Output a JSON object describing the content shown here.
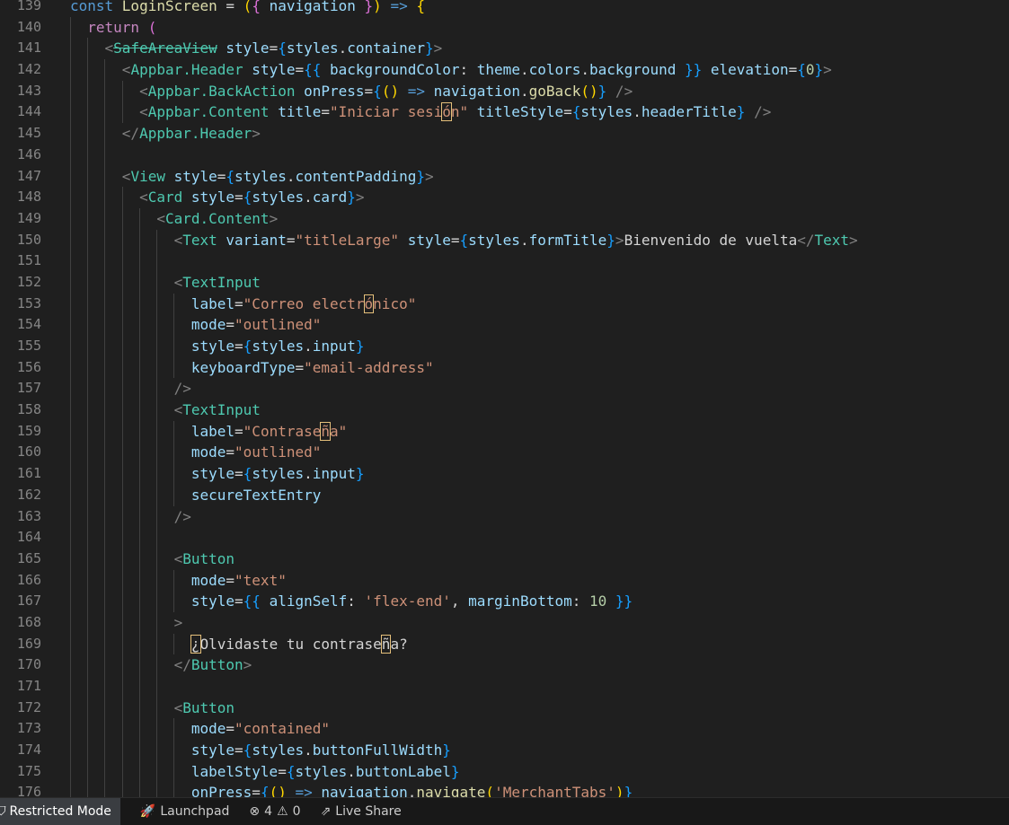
{
  "editor": {
    "lines": [
      {
        "n": "139",
        "indent": 0,
        "toks": [
          [
            "const ",
            "kw"
          ],
          [
            "LoginScreen",
            "fn"
          ],
          [
            " = ",
            "op"
          ],
          [
            "(",
            "b1"
          ],
          [
            "{ ",
            "b2"
          ],
          [
            "navigation",
            "var"
          ],
          [
            " }",
            "b2"
          ],
          [
            ")",
            "b1"
          ],
          [
            " => ",
            "kw"
          ],
          [
            "{",
            "b1"
          ]
        ]
      },
      {
        "n": "140",
        "indent": 1,
        "toks": [
          [
            "  return ",
            "ctl"
          ],
          [
            "(",
            "b2"
          ]
        ]
      },
      {
        "n": "141",
        "indent": 2,
        "toks": [
          [
            "    ",
            ""
          ],
          [
            "<",
            "brk"
          ],
          [
            "SafeAreaView",
            "tag strike"
          ],
          [
            " style",
            "attr"
          ],
          [
            "=",
            "op"
          ],
          [
            "{",
            "b3"
          ],
          [
            "styles",
            "var"
          ],
          [
            ".",
            "op"
          ],
          [
            "container",
            "var"
          ],
          [
            "}",
            "b3"
          ],
          [
            ">",
            "brk"
          ]
        ]
      },
      {
        "n": "142",
        "indent": 3,
        "toks": [
          [
            "      ",
            ""
          ],
          [
            "<",
            "brk"
          ],
          [
            "Appbar.Header",
            "tag"
          ],
          [
            " style",
            "attr"
          ],
          [
            "=",
            "op"
          ],
          [
            "{{ ",
            "b3"
          ],
          [
            "backgroundColor",
            "var"
          ],
          [
            ": ",
            "op"
          ],
          [
            "theme",
            "var"
          ],
          [
            ".",
            "op"
          ],
          [
            "colors",
            "var"
          ],
          [
            ".",
            "op"
          ],
          [
            "background",
            "var"
          ],
          [
            " }}",
            "b3"
          ],
          [
            " elevation",
            "attr"
          ],
          [
            "=",
            "op"
          ],
          [
            "{",
            "b3"
          ],
          [
            "0",
            "num"
          ],
          [
            "}",
            "b3"
          ],
          [
            ">",
            "brk"
          ]
        ]
      },
      {
        "n": "143",
        "indent": 4,
        "toks": [
          [
            "        ",
            ""
          ],
          [
            "<",
            "brk"
          ],
          [
            "Appbar.BackAction",
            "tag"
          ],
          [
            " onPress",
            "attr"
          ],
          [
            "=",
            "op"
          ],
          [
            "{",
            "b3"
          ],
          [
            "() ",
            "b1"
          ],
          [
            "=> ",
            "kw"
          ],
          [
            "navigation",
            "var"
          ],
          [
            ".",
            "op"
          ],
          [
            "goBack",
            "fn"
          ],
          [
            "()",
            "b1"
          ],
          [
            "}",
            "b3"
          ],
          [
            " />",
            "brk"
          ]
        ]
      },
      {
        "n": "144",
        "indent": 4,
        "toks": [
          [
            "        ",
            ""
          ],
          [
            "<",
            "brk"
          ],
          [
            "Appbar.Content",
            "tag"
          ],
          [
            " title",
            "attr"
          ],
          [
            "=",
            "op"
          ],
          [
            "\"Iniciar sesi",
            "str"
          ],
          [
            "ó",
            "str hl"
          ],
          [
            "n\"",
            "str"
          ],
          [
            " titleStyle",
            "attr"
          ],
          [
            "=",
            "op"
          ],
          [
            "{",
            "b3"
          ],
          [
            "styles",
            "var"
          ],
          [
            ".",
            "op"
          ],
          [
            "headerTitle",
            "var"
          ],
          [
            "}",
            "b3"
          ],
          [
            " />",
            "brk"
          ]
        ]
      },
      {
        "n": "145",
        "indent": 3,
        "toks": [
          [
            "      ",
            ""
          ],
          [
            "</",
            "brk"
          ],
          [
            "Appbar.Header",
            "tag"
          ],
          [
            ">",
            "brk"
          ]
        ]
      },
      {
        "n": "146",
        "indent": 3,
        "toks": []
      },
      {
        "n": "147",
        "indent": 3,
        "toks": [
          [
            "      ",
            ""
          ],
          [
            "<",
            "brk"
          ],
          [
            "View",
            "tag"
          ],
          [
            " style",
            "attr"
          ],
          [
            "=",
            "op"
          ],
          [
            "{",
            "b3"
          ],
          [
            "styles",
            "var"
          ],
          [
            ".",
            "op"
          ],
          [
            "contentPadding",
            "var"
          ],
          [
            "}",
            "b3"
          ],
          [
            ">",
            "brk"
          ]
        ]
      },
      {
        "n": "148",
        "indent": 4,
        "toks": [
          [
            "        ",
            ""
          ],
          [
            "<",
            "brk"
          ],
          [
            "Card",
            "tag"
          ],
          [
            " style",
            "attr"
          ],
          [
            "=",
            "op"
          ],
          [
            "{",
            "b3"
          ],
          [
            "styles",
            "var"
          ],
          [
            ".",
            "op"
          ],
          [
            "card",
            "var"
          ],
          [
            "}",
            "b3"
          ],
          [
            ">",
            "brk"
          ]
        ]
      },
      {
        "n": "149",
        "indent": 5,
        "toks": [
          [
            "          ",
            ""
          ],
          [
            "<",
            "brk"
          ],
          [
            "Card.Content",
            "tag"
          ],
          [
            ">",
            "brk"
          ]
        ]
      },
      {
        "n": "150",
        "indent": 6,
        "toks": [
          [
            "            ",
            ""
          ],
          [
            "<",
            "brk"
          ],
          [
            "Text",
            "tag"
          ],
          [
            " variant",
            "attr"
          ],
          [
            "=",
            "op"
          ],
          [
            "\"titleLarge\"",
            "str"
          ],
          [
            " style",
            "attr"
          ],
          [
            "=",
            "op"
          ],
          [
            "{",
            "b3"
          ],
          [
            "styles",
            "var"
          ],
          [
            ".",
            "op"
          ],
          [
            "formTitle",
            "var"
          ],
          [
            "}",
            "b3"
          ],
          [
            ">",
            "brk"
          ],
          [
            "Bienvenido de vuelta",
            "op"
          ],
          [
            "</",
            "brk"
          ],
          [
            "Text",
            "tag"
          ],
          [
            ">",
            "brk"
          ]
        ]
      },
      {
        "n": "151",
        "indent": 6,
        "toks": []
      },
      {
        "n": "152",
        "indent": 6,
        "toks": [
          [
            "            ",
            ""
          ],
          [
            "<",
            "brk"
          ],
          [
            "TextInput",
            "tag"
          ]
        ]
      },
      {
        "n": "153",
        "indent": 7,
        "toks": [
          [
            "              label",
            "attr"
          ],
          [
            "=",
            "op"
          ],
          [
            "\"Correo electr",
            "str"
          ],
          [
            "ó",
            "str hl"
          ],
          [
            "nico\"",
            "str"
          ]
        ]
      },
      {
        "n": "154",
        "indent": 7,
        "toks": [
          [
            "              mode",
            "attr"
          ],
          [
            "=",
            "op"
          ],
          [
            "\"outlined\"",
            "str"
          ]
        ]
      },
      {
        "n": "155",
        "indent": 7,
        "toks": [
          [
            "              style",
            "attr"
          ],
          [
            "=",
            "op"
          ],
          [
            "{",
            "b3"
          ],
          [
            "styles",
            "var"
          ],
          [
            ".",
            "op"
          ],
          [
            "input",
            "var"
          ],
          [
            "}",
            "b3"
          ]
        ]
      },
      {
        "n": "156",
        "indent": 7,
        "toks": [
          [
            "              keyboardType",
            "attr"
          ],
          [
            "=",
            "op"
          ],
          [
            "\"email-address\"",
            "str"
          ]
        ]
      },
      {
        "n": "157",
        "indent": 6,
        "toks": [
          [
            "            ",
            ""
          ],
          [
            "/>",
            "brk"
          ]
        ]
      },
      {
        "n": "158",
        "indent": 6,
        "toks": [
          [
            "            ",
            ""
          ],
          [
            "<",
            "brk"
          ],
          [
            "TextInput",
            "tag"
          ]
        ]
      },
      {
        "n": "159",
        "indent": 7,
        "toks": [
          [
            "              label",
            "attr"
          ],
          [
            "=",
            "op"
          ],
          [
            "\"Contrase",
            "str"
          ],
          [
            "ñ",
            "str hl"
          ],
          [
            "a\"",
            "str"
          ]
        ]
      },
      {
        "n": "160",
        "indent": 7,
        "toks": [
          [
            "              mode",
            "attr"
          ],
          [
            "=",
            "op"
          ],
          [
            "\"outlined\"",
            "str"
          ]
        ]
      },
      {
        "n": "161",
        "indent": 7,
        "toks": [
          [
            "              style",
            "attr"
          ],
          [
            "=",
            "op"
          ],
          [
            "{",
            "b3"
          ],
          [
            "styles",
            "var"
          ],
          [
            ".",
            "op"
          ],
          [
            "input",
            "var"
          ],
          [
            "}",
            "b3"
          ]
        ]
      },
      {
        "n": "162",
        "indent": 7,
        "toks": [
          [
            "              secureTextEntry",
            "attr"
          ]
        ]
      },
      {
        "n": "163",
        "indent": 6,
        "toks": [
          [
            "            ",
            ""
          ],
          [
            "/>",
            "brk"
          ]
        ]
      },
      {
        "n": "164",
        "indent": 6,
        "toks": []
      },
      {
        "n": "165",
        "indent": 6,
        "toks": [
          [
            "            ",
            ""
          ],
          [
            "<",
            "brk"
          ],
          [
            "Button",
            "tag"
          ]
        ]
      },
      {
        "n": "166",
        "indent": 7,
        "toks": [
          [
            "              mode",
            "attr"
          ],
          [
            "=",
            "op"
          ],
          [
            "\"text\"",
            "str"
          ]
        ]
      },
      {
        "n": "167",
        "indent": 7,
        "toks": [
          [
            "              style",
            "attr"
          ],
          [
            "=",
            "op"
          ],
          [
            "{{ ",
            "b3"
          ],
          [
            "alignSelf",
            "var"
          ],
          [
            ": ",
            "op"
          ],
          [
            "'flex-end'",
            "str"
          ],
          [
            ", ",
            "op"
          ],
          [
            "marginBottom",
            "var"
          ],
          [
            ": ",
            "op"
          ],
          [
            "10",
            "num"
          ],
          [
            " }}",
            "b3"
          ]
        ]
      },
      {
        "n": "168",
        "indent": 6,
        "toks": [
          [
            "            ",
            ""
          ],
          [
            ">",
            "brk"
          ]
        ]
      },
      {
        "n": "169",
        "indent": 7,
        "toks": [
          [
            "              ",
            ""
          ],
          [
            "¿",
            "op hl"
          ],
          [
            "Olvidaste tu contrase",
            "op"
          ],
          [
            "ñ",
            "op hl"
          ],
          [
            "a?",
            "op"
          ]
        ]
      },
      {
        "n": "170",
        "indent": 6,
        "toks": [
          [
            "            ",
            ""
          ],
          [
            "</",
            "brk"
          ],
          [
            "Button",
            "tag"
          ],
          [
            ">",
            "brk"
          ]
        ]
      },
      {
        "n": "171",
        "indent": 6,
        "toks": []
      },
      {
        "n": "172",
        "indent": 6,
        "toks": [
          [
            "            ",
            ""
          ],
          [
            "<",
            "brk"
          ],
          [
            "Button",
            "tag"
          ]
        ]
      },
      {
        "n": "173",
        "indent": 7,
        "toks": [
          [
            "              mode",
            "attr"
          ],
          [
            "=",
            "op"
          ],
          [
            "\"contained\"",
            "str"
          ]
        ]
      },
      {
        "n": "174",
        "indent": 7,
        "toks": [
          [
            "              style",
            "attr"
          ],
          [
            "=",
            "op"
          ],
          [
            "{",
            "b3"
          ],
          [
            "styles",
            "var"
          ],
          [
            ".",
            "op"
          ],
          [
            "buttonFullWidth",
            "var"
          ],
          [
            "}",
            "b3"
          ]
        ]
      },
      {
        "n": "175",
        "indent": 7,
        "toks": [
          [
            "              labelStyle",
            "attr"
          ],
          [
            "=",
            "op"
          ],
          [
            "{",
            "b3"
          ],
          [
            "styles",
            "var"
          ],
          [
            ".",
            "op"
          ],
          [
            "buttonLabel",
            "var"
          ],
          [
            "}",
            "b3"
          ]
        ]
      },
      {
        "n": "176",
        "indent": 7,
        "toks": [
          [
            "              onPress",
            "attr"
          ],
          [
            "=",
            "op"
          ],
          [
            "{",
            "b3"
          ],
          [
            "() ",
            "b1"
          ],
          [
            "=> ",
            "kw"
          ],
          [
            "navigation",
            "var"
          ],
          [
            ".",
            "op"
          ],
          [
            "navigate",
            "fn"
          ],
          [
            "(",
            "b1"
          ],
          [
            "'MerchantTabs'",
            "str"
          ],
          [
            ")",
            "b1"
          ],
          [
            "}",
            "b3"
          ]
        ]
      }
    ]
  },
  "statusbar": {
    "restricted_label": "Restricted Mode",
    "launchpad_label": "Launchpad",
    "errors_count": "4",
    "warnings_count": "0",
    "liveshare_label": "Live Share",
    "icons": {
      "restricted": "shield-icon",
      "launchpad": "rocket-icon",
      "errors": "error-circle-icon",
      "warnings": "warning-icon",
      "liveshare": "live-share-icon"
    }
  }
}
